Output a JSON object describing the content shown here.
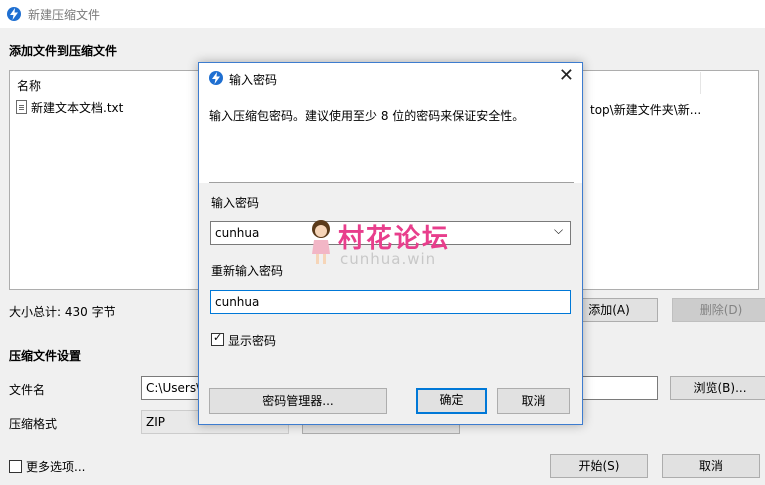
{
  "window": {
    "title": "新建压缩文件",
    "section_add": "添加文件到压缩文件",
    "list": {
      "column_name": "名称",
      "items": [
        {
          "name": "新建文本文档.txt",
          "path": "top\\新建文件夹\\新..."
        }
      ]
    },
    "total_size": "大小总计: 430 字节",
    "add_button": "添加(A)",
    "delete_button": "删除(D)",
    "section_settings": "压缩文件设置",
    "filename_label": "文件名",
    "filename_value": "C:\\Users\\",
    "browse_button": "浏览(B)...",
    "format_label": "压缩格式",
    "format_value": "ZIP",
    "more_options": "更多选项...",
    "start_button": "开始(S)",
    "cancel_button": "取消"
  },
  "dialog": {
    "title": "输入密码",
    "description": "输入压缩包密码。建议使用至少 8 位的密码来保证安全性。",
    "password_label": "输入密码",
    "password_value": "cunhua",
    "confirm_label": "重新输入密码",
    "confirm_value": "cunhua",
    "show_password": "显示密码",
    "show_password_checked": true,
    "manager_button": "密码管理器...",
    "ok_button": "确定",
    "cancel_button": "取消"
  },
  "watermark": {
    "title": "村花论坛",
    "subtitle": "cunhua.win"
  },
  "colors": {
    "accent": "#0078d7",
    "app_icon": "#1f6fd1",
    "watermark": "#e83e8c"
  }
}
